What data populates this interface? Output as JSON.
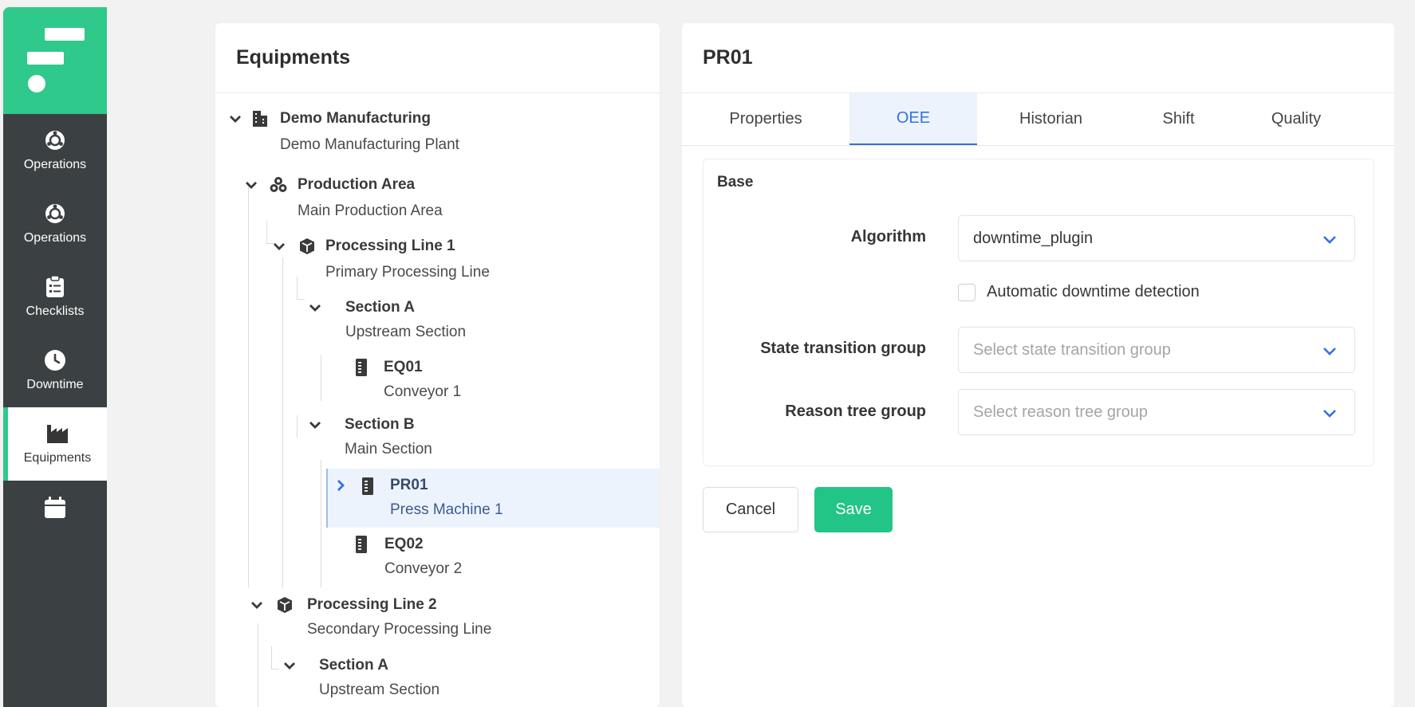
{
  "sidebar": {
    "items": [
      {
        "label": "Operations",
        "icon": "operations-icon"
      },
      {
        "label": "Operations",
        "icon": "operations-icon"
      },
      {
        "label": "Checklists",
        "icon": "clipboard-icon"
      },
      {
        "label": "Downtime",
        "icon": "clock-icon"
      },
      {
        "label": "Equipments",
        "icon": "factory-icon",
        "active": true
      },
      {
        "label": "",
        "icon": "calendar-icon"
      }
    ]
  },
  "equipments": {
    "title": "Equipments",
    "tree": [
      {
        "title": "Demo Manufacturing",
        "subtitle": "Demo Manufacturing Plant"
      },
      {
        "title": "Production Area",
        "subtitle": "Main Production Area"
      },
      {
        "title": "Processing Line 1",
        "subtitle": "Primary Processing Line"
      },
      {
        "title": "Section A",
        "subtitle": "Upstream Section"
      },
      {
        "title": "EQ01",
        "subtitle": "Conveyor 1"
      },
      {
        "title": "Section B",
        "subtitle": "Main Section"
      },
      {
        "title": "PR01",
        "subtitle": "Press Machine 1"
      },
      {
        "title": "EQ02",
        "subtitle": "Conveyor 2"
      },
      {
        "title": "Processing Line 2",
        "subtitle": "Secondary Processing Line"
      },
      {
        "title": "Section A",
        "subtitle": "Upstream Section"
      }
    ]
  },
  "detail": {
    "title": "PR01",
    "tabs": [
      "Properties",
      "OEE",
      "Historian",
      "Shift",
      "Quality"
    ],
    "active_tab": "OEE",
    "section_title": "Base",
    "algorithm_label": "Algorithm",
    "algorithm_value": "downtime_plugin",
    "auto_downtime_label": "Automatic downtime detection",
    "state_group_label": "State transition group",
    "state_group_placeholder": "Select state transition group",
    "reason_group_label": "Reason tree group",
    "reason_group_placeholder": "Select reason tree group",
    "cancel_label": "Cancel",
    "save_label": "Save"
  },
  "colors": {
    "brand": "#2fc98b",
    "sidebar": "#3b4142",
    "accent": "#3273dc",
    "save": "#22c585"
  }
}
